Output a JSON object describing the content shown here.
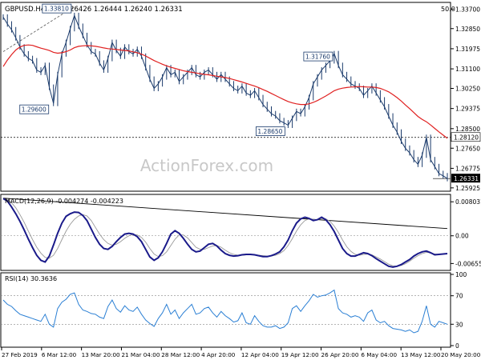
{
  "chart_data": [
    {
      "panel": "price",
      "type": "line",
      "title": "GBPUSD.H4",
      "ohlc_text": "1.26426 1.26444 1.26240 1.26331",
      "corner_value": "50.0",
      "watermark": "ActionForex.com",
      "y_ticks": [
        "1.33700",
        "1.32850",
        "1.31975",
        "1.31100",
        "1.30250",
        "1.29375",
        "1.28500",
        "1.27650",
        "1.26775",
        "1.25925"
      ],
      "ylim": [
        1.2585,
        1.3392
      ],
      "last_price_label": "1.26331",
      "last_price": 1.26331,
      "hline_label": "1.28120",
      "hline_value": 1.2812,
      "annotations": [
        {
          "text": "1.33810",
          "x": 17,
          "y": 1.3381
        },
        {
          "text": "1.29600",
          "x": 12,
          "y": 1.296
        },
        {
          "text": "1.28650",
          "x": 68,
          "y": 1.2865
        },
        {
          "text": "1.31760",
          "x": 79,
          "y": 1.3176
        }
      ],
      "trendline": {
        "x": [
          0,
          17
        ],
        "y": [
          1.3185,
          1.3381
        ]
      },
      "series": [
        {
          "name": "Price",
          "values": [
            1.3335,
            1.3305,
            1.328,
            1.3245,
            1.3205,
            1.3175,
            1.3155,
            1.3145,
            1.3105,
            1.3095,
            1.3125,
            1.303,
            1.296,
            1.3085,
            1.3175,
            1.3225,
            1.3285,
            1.3342,
            1.3295,
            1.3255,
            1.3215,
            1.3185,
            1.3175,
            1.3135,
            1.3105,
            1.3155,
            1.3225,
            1.319,
            1.3165,
            1.3205,
            1.3185,
            1.3175,
            1.3195,
            1.3165,
            1.3115,
            1.3065,
            1.3025,
            1.3045,
            1.3075,
            1.3115,
            1.3085,
            1.3095,
            1.3055,
            1.3075,
            1.3095,
            1.3115,
            1.3085,
            1.3075,
            1.3095,
            1.3105,
            1.3085,
            1.3065,
            1.3085,
            1.3065,
            1.3045,
            1.3025,
            1.3015,
            1.3035,
            1.3005,
            1.2995,
            1.3015,
            1.2985,
            1.2955,
            1.2935,
            1.2915,
            1.2905,
            1.2885,
            1.2875,
            1.2865,
            1.2895,
            1.2925,
            1.2915,
            1.2945,
            1.2985,
            1.3045,
            1.3075,
            1.3105,
            1.3125,
            1.3145,
            1.3176,
            1.3125,
            1.3085,
            1.3065,
            1.3045,
            1.3035,
            1.3025,
            1.2995,
            1.3015,
            1.3035,
            1.3005,
            1.2975,
            1.2945,
            1.2905,
            1.2865,
            1.2835,
            1.2795,
            1.2765,
            1.2745,
            1.2715,
            1.2695,
            1.2735,
            1.2812,
            1.2715,
            1.2685,
            1.2655,
            1.2645,
            1.2633
          ]
        },
        {
          "name": "EMA",
          "values": [
            1.312,
            1.3148,
            1.3172,
            1.3192,
            1.3205,
            1.3212,
            1.3214,
            1.3212,
            1.3206,
            1.32,
            1.3195,
            1.319,
            1.3182,
            1.3178,
            1.318,
            1.3185,
            1.3192,
            1.3202,
            1.3208,
            1.321,
            1.3211,
            1.321,
            1.3208,
            1.3205,
            1.3201,
            1.3198,
            1.3196,
            1.3194,
            1.3192,
            1.319,
            1.3188,
            1.3184,
            1.318,
            1.3174,
            1.3166,
            1.3156,
            1.3146,
            1.3138,
            1.313,
            1.3123,
            1.3117,
            1.3112,
            1.3107,
            1.3102,
            1.3098,
            1.3095,
            1.3092,
            1.3089,
            1.3086,
            1.3084,
            1.3081,
            1.3078,
            1.3075,
            1.3072,
            1.3068,
            1.3063,
            1.3058,
            1.3053,
            1.3047,
            1.3041,
            1.3035,
            1.3028,
            1.302,
            1.3012,
            1.3003,
            1.2994,
            1.2985,
            1.2976,
            1.2968,
            1.2962,
            1.2958,
            1.2955,
            1.2955,
            1.2958,
            1.2964,
            1.2972,
            1.2982,
            1.2992,
            1.3003,
            1.3015,
            1.3022,
            1.3026,
            1.3029,
            1.3031,
            1.3032,
            1.3033,
            1.3032,
            1.3031,
            1.3031,
            1.3029,
            1.3025,
            1.3018,
            1.301,
            1.2998,
            1.2985,
            1.297,
            1.2953,
            1.2937,
            1.292,
            1.2903,
            1.289,
            1.288,
            1.2866,
            1.2851,
            1.2836,
            1.2822,
            1.2808
          ]
        }
      ]
    },
    {
      "panel": "macd",
      "type": "line",
      "title": "MACD(12,26,9) -0.004274 -0.004223",
      "y_ticks": [
        "0.008031",
        "0.00",
        "-0.00655"
      ],
      "tick_values": [
        0.008031,
        0,
        -0.00655
      ],
      "ylim": [
        -0.0078,
        0.0094
      ],
      "trendline": {
        "x": [
          0,
          106
        ],
        "y": [
          0.0089,
          0.0017
        ]
      },
      "series": [
        {
          "name": "MACD",
          "values": [
            0.0088,
            0.0082,
            0.0068,
            0.0052,
            0.0034,
            0.0014,
            -0.0008,
            -0.0028,
            -0.0046,
            -0.0058,
            -0.0062,
            -0.0048,
            -0.0022,
            0.0006,
            0.003,
            0.0046,
            0.0052,
            0.0056,
            0.0055,
            0.0048,
            0.0036,
            0.0016,
            -0.0004,
            -0.002,
            -0.003,
            -0.0032,
            -0.0025,
            -0.0014,
            -0.0004,
            0.0004,
            0.0006,
            0.0004,
            -0.0002,
            -0.0014,
            -0.0032,
            -0.005,
            -0.0058,
            -0.0052,
            -0.0038,
            -0.0018,
            0.0004,
            0.0012,
            0.0006,
            -0.0006,
            -0.002,
            -0.0032,
            -0.0038,
            -0.0036,
            -0.0028,
            -0.002,
            -0.0018,
            -0.0024,
            -0.0034,
            -0.0042,
            -0.0046,
            -0.0048,
            -0.0047,
            -0.0045,
            -0.0044,
            -0.0044,
            -0.0045,
            -0.0047,
            -0.0049,
            -0.0049,
            -0.0047,
            -0.0043,
            -0.0038,
            -0.0026,
            -0.001,
            0.0012,
            0.003,
            0.004,
            0.0044,
            0.0041,
            0.0036,
            0.0038,
            0.0044,
            0.0038,
            0.0026,
            0.001,
            -0.001,
            -0.003,
            -0.0042,
            -0.0048,
            -0.0048,
            -0.0044,
            -0.004,
            -0.0042,
            -0.0047,
            -0.0054,
            -0.006,
            -0.0066,
            -0.0072,
            -0.0074,
            -0.0072,
            -0.0068,
            -0.0062,
            -0.0056,
            -0.0048,
            -0.0042,
            -0.0038,
            -0.0036,
            -0.004,
            -0.0045,
            -0.0044,
            -0.0043,
            -0.0042
          ]
        },
        {
          "name": "Signal",
          "values": [
            0.0086,
            0.0085,
            0.0078,
            0.0066,
            0.005,
            0.0032,
            0.0011,
            -0.0009,
            -0.0027,
            -0.0041,
            -0.0051,
            -0.0053,
            -0.0046,
            -0.003,
            -0.0009,
            0.0011,
            0.0027,
            0.0039,
            0.0047,
            0.005,
            0.0047,
            0.0036,
            0.002,
            0.0004,
            -0.0009,
            -0.0018,
            -0.0022,
            -0.002,
            -0.0014,
            -0.0006,
            0.0,
            0.0003,
            0.0002,
            -0.0004,
            -0.0015,
            -0.003,
            -0.0043,
            -0.0049,
            -0.0047,
            -0.0038,
            -0.0023,
            -0.0008,
            0.0002,
            0.0002,
            -0.0005,
            -0.0016,
            -0.0027,
            -0.0032,
            -0.0032,
            -0.0028,
            -0.0024,
            -0.0023,
            -0.0027,
            -0.0034,
            -0.004,
            -0.0044,
            -0.0046,
            -0.0046,
            -0.0045,
            -0.0045,
            -0.0045,
            -0.0046,
            -0.0047,
            -0.0048,
            -0.0048,
            -0.0046,
            -0.0042,
            -0.0035,
            -0.0023,
            -0.0007,
            0.0011,
            0.0026,
            0.0036,
            0.004,
            0.0039,
            0.0038,
            0.004,
            0.004,
            0.0034,
            0.0023,
            0.0008,
            -0.001,
            -0.0026,
            -0.0037,
            -0.0044,
            -0.0046,
            -0.0044,
            -0.0043,
            -0.0045,
            -0.005,
            -0.0055,
            -0.0061,
            -0.0067,
            -0.0071,
            -0.0072,
            -0.007,
            -0.0066,
            -0.006,
            -0.0053,
            -0.0047,
            -0.0042,
            -0.0039,
            -0.004,
            -0.0043,
            -0.0044,
            -0.0043,
            -0.0042
          ]
        }
      ]
    },
    {
      "panel": "rsi",
      "type": "line",
      "title": "RSI(14) 30.3636",
      "y_ticks": [
        "100",
        "70",
        "30",
        "0"
      ],
      "tick_values": [
        100,
        70,
        30,
        0
      ],
      "ylim": [
        0,
        100
      ],
      "levels": [
        70,
        30
      ],
      "series": [
        {
          "name": "RSI",
          "values": [
            64,
            58,
            55,
            49,
            44,
            42,
            40,
            38,
            36,
            34,
            44,
            30,
            26,
            52,
            61,
            65,
            72,
            74,
            58,
            50,
            48,
            45,
            44,
            40,
            38,
            55,
            64,
            52,
            47,
            56,
            50,
            48,
            54,
            44,
            36,
            31,
            27,
            38,
            46,
            58,
            44,
            50,
            38,
            46,
            52,
            58,
            44,
            46,
            52,
            54,
            46,
            40,
            48,
            42,
            38,
            33,
            35,
            46,
            32,
            30,
            42,
            34,
            28,
            26,
            26,
            28,
            24,
            26,
            32,
            52,
            56,
            48,
            56,
            63,
            72,
            68,
            70,
            71,
            74,
            78,
            52,
            46,
            44,
            40,
            42,
            40,
            34,
            46,
            50,
            36,
            32,
            34,
            28,
            24,
            23,
            22,
            20,
            22,
            18,
            20,
            34,
            56,
            30,
            26,
            34,
            32,
            30
          ]
        }
      ]
    },
    {
      "panel": "time_axis",
      "type": "table",
      "x_labels": [
        "27 Feb 2019",
        "6 Mar 12:00",
        "13 Mar 20:00",
        "21 Mar 04:00",
        "28 Mar 12:00",
        "4 Apr 20:00",
        "12 Apr 04:00",
        "19 Apr 12:00",
        "26 Apr 20:00",
        "6 May 04:00",
        "13 May 12:00",
        "20 May 20:00"
      ]
    }
  ]
}
